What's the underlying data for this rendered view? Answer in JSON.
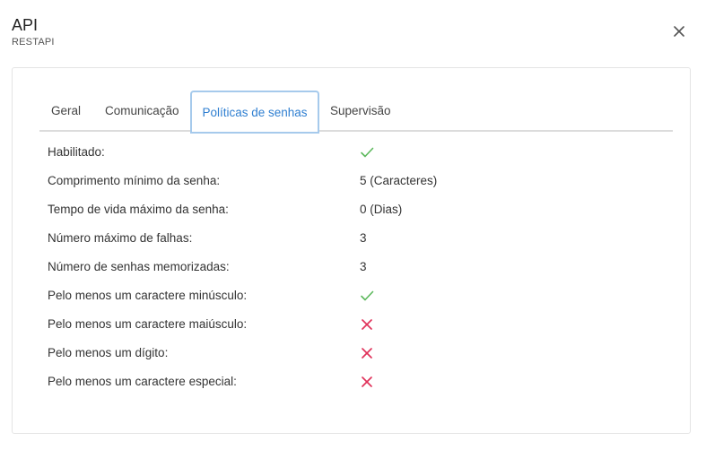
{
  "dialog": {
    "title": "API",
    "subtitle": "RESTAPI",
    "close_icon": "close-icon"
  },
  "tabs": [
    {
      "label": "Geral",
      "active": false
    },
    {
      "label": "Comunicação",
      "active": false
    },
    {
      "label": "Políticas de senhas",
      "active": true
    },
    {
      "label": "Supervisão",
      "active": false
    }
  ],
  "policy": {
    "rows": [
      {
        "label": "Habilitado:",
        "value": "",
        "icon": "check-icon"
      },
      {
        "label": "Comprimento mínimo da senha:",
        "value": "5 (Caracteres)",
        "icon": ""
      },
      {
        "label": "Tempo de vida máximo da senha:",
        "value": "0 (Dias)",
        "icon": ""
      },
      {
        "label": "Número máximo de falhas:",
        "value": "3",
        "icon": ""
      },
      {
        "label": "Número de senhas memorizadas:",
        "value": "3",
        "icon": ""
      },
      {
        "label": "Pelo menos um caractere minúsculo:",
        "value": "",
        "icon": "check-icon"
      },
      {
        "label": "Pelo menos um caractere maiúsculo:",
        "value": "",
        "icon": "x-icon"
      },
      {
        "label": "Pelo menos um dígito:",
        "value": "",
        "icon": "x-icon"
      },
      {
        "label": "Pelo menos um caractere especial:",
        "value": "",
        "icon": "x-icon"
      }
    ]
  },
  "colors": {
    "active_tab_text": "#2f7fd1",
    "active_tab_border": "#a6caec",
    "check_color": "#5cb85c",
    "x_color": "#e0325a"
  }
}
